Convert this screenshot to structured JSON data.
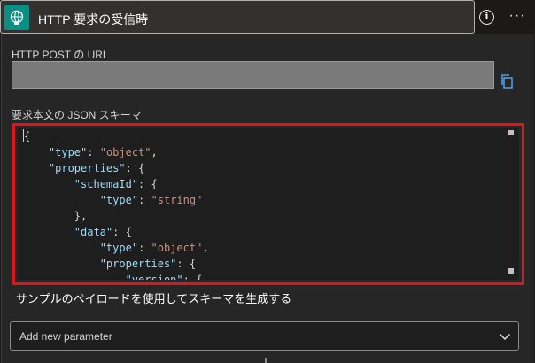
{
  "header": {
    "title": "HTTP 要求の受信時",
    "icon": "http-request-icon",
    "info_icon": "info-icon",
    "more_icon": "more-options-icon"
  },
  "url_section": {
    "label": "HTTP POST の URL",
    "value": "",
    "copy_icon": "copy-icon"
  },
  "schema_section": {
    "label": "要求本文の JSON スキーマ",
    "code_lines": [
      "{",
      "    \"type\": \"object\",",
      "    \"properties\": {",
      "        \"schemaId\": {",
      "            \"type\": \"string\"",
      "        },",
      "        \"data\": {",
      "            \"type\": \"object\",",
      "            \"properties\": {",
      "                \"version\": {"
    ]
  },
  "generate_link": "サンプルのペイロードを使用してスキーマを生成する",
  "add_parameter": {
    "label": "Add new parameter",
    "icon": "chevron-down-icon"
  },
  "colors": {
    "accent": "#0a8f84",
    "highlight_border": "#e0141c",
    "json_key": "#9cdcfe",
    "json_string": "#ce9178"
  }
}
